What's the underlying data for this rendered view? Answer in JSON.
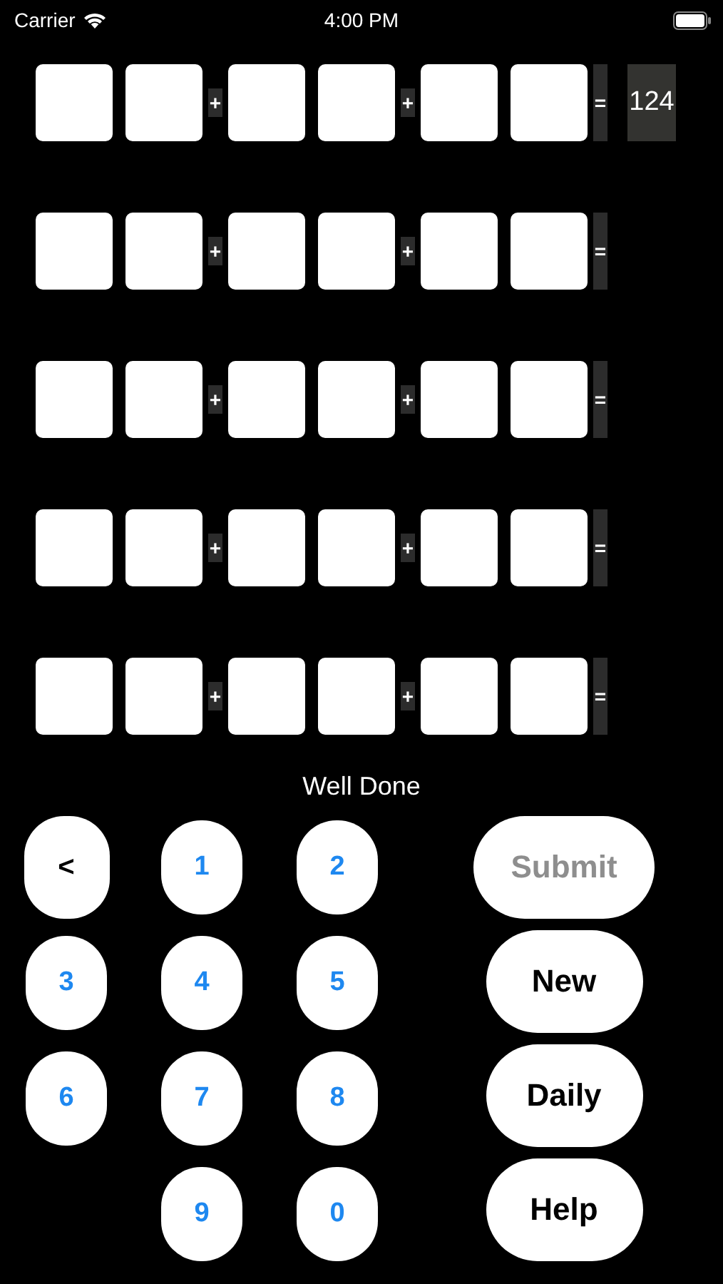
{
  "status_bar": {
    "carrier": "Carrier",
    "time": "4:00 PM"
  },
  "equations": [
    {
      "parts": [
        {
          "kind": "box"
        },
        {
          "kind": "box"
        },
        {
          "kind": "op",
          "text": "+"
        },
        {
          "kind": "box"
        },
        {
          "kind": "box"
        },
        {
          "kind": "op",
          "text": "+"
        },
        {
          "kind": "box"
        },
        {
          "kind": "box"
        },
        {
          "kind": "op",
          "text": "="
        }
      ],
      "result": "124"
    },
    {
      "parts": [
        {
          "kind": "box"
        },
        {
          "kind": "box"
        },
        {
          "kind": "op",
          "text": "+"
        },
        {
          "kind": "box"
        },
        {
          "kind": "box"
        },
        {
          "kind": "op",
          "text": "+"
        },
        {
          "kind": "box"
        },
        {
          "kind": "box"
        },
        {
          "kind": "op",
          "text": "="
        }
      ]
    },
    {
      "parts": [
        {
          "kind": "box"
        },
        {
          "kind": "box"
        },
        {
          "kind": "op",
          "text": "+"
        },
        {
          "kind": "box"
        },
        {
          "kind": "box"
        },
        {
          "kind": "op",
          "text": "+"
        },
        {
          "kind": "box"
        },
        {
          "kind": "box"
        },
        {
          "kind": "op",
          "text": "="
        }
      ]
    },
    {
      "parts": [
        {
          "kind": "box"
        },
        {
          "kind": "box"
        },
        {
          "kind": "op",
          "text": "+"
        },
        {
          "kind": "box"
        },
        {
          "kind": "box"
        },
        {
          "kind": "op",
          "text": "+"
        },
        {
          "kind": "box"
        },
        {
          "kind": "box"
        },
        {
          "kind": "op",
          "text": "="
        }
      ]
    },
    {
      "parts": [
        {
          "kind": "box"
        },
        {
          "kind": "box"
        },
        {
          "kind": "op",
          "text": "+"
        },
        {
          "kind": "box"
        },
        {
          "kind": "box"
        },
        {
          "kind": "op",
          "text": "+"
        },
        {
          "kind": "box"
        },
        {
          "kind": "box"
        },
        {
          "kind": "op",
          "text": "="
        }
      ]
    }
  ],
  "message": "Well Done",
  "keypad": [
    [
      {
        "kind": "back",
        "label": "<"
      },
      {
        "kind": "digit",
        "label": "1"
      },
      {
        "kind": "digit",
        "label": "2"
      }
    ],
    [
      {
        "kind": "digit",
        "label": "3"
      },
      {
        "kind": "digit",
        "label": "4"
      },
      {
        "kind": "digit",
        "label": "5"
      }
    ],
    [
      {
        "kind": "digit",
        "label": "6"
      },
      {
        "kind": "digit",
        "label": "7"
      },
      {
        "kind": "digit",
        "label": "8"
      }
    ],
    [
      {
        "kind": "digit",
        "label": "9"
      },
      {
        "kind": "digit",
        "label": "0"
      }
    ]
  ],
  "actions": [
    {
      "label": "Submit",
      "disabled": true
    },
    {
      "label": "New",
      "disabled": false
    },
    {
      "label": "Daily",
      "disabled": false
    },
    {
      "label": "Help",
      "disabled": false
    }
  ]
}
